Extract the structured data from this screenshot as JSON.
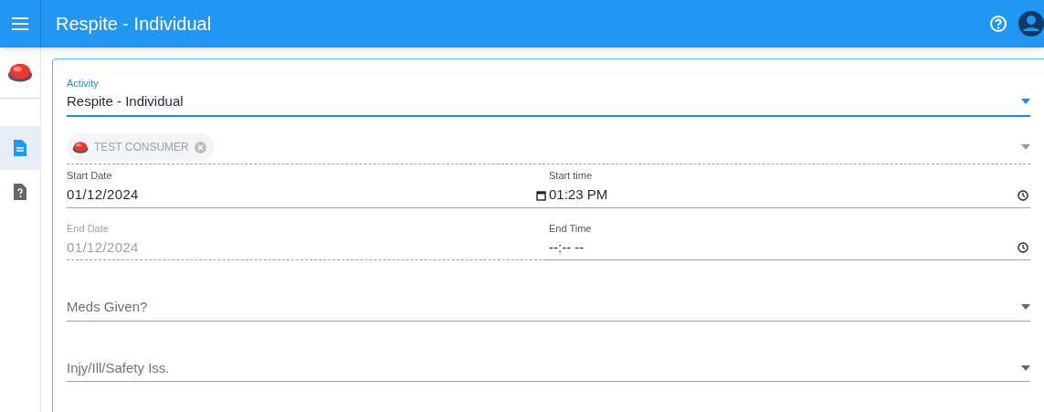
{
  "header": {
    "title": "Respite - Individual"
  },
  "sidebar": {
    "items": [
      {
        "kind": "document",
        "selected": true
      },
      {
        "kind": "help-document",
        "selected": false
      }
    ]
  },
  "form": {
    "activity": {
      "label": "Activity",
      "value": "Respite - Individual",
      "focused": true
    },
    "consumers": [
      {
        "name": "TEST CONSUMER"
      }
    ],
    "start": {
      "date_label": "Start Date",
      "date": "01/12/2024",
      "date_disabled": false,
      "time_label": "Start time",
      "time": "01:23 PM"
    },
    "end": {
      "date_label": "End Date",
      "date": "01/12/2024",
      "date_disabled": true,
      "time_label": "End Time",
      "time": "--:-- --"
    },
    "selects": [
      {
        "placeholder": "Meds Given?"
      },
      {
        "placeholder": "Injy/Ill/Safety Iss."
      }
    ]
  }
}
